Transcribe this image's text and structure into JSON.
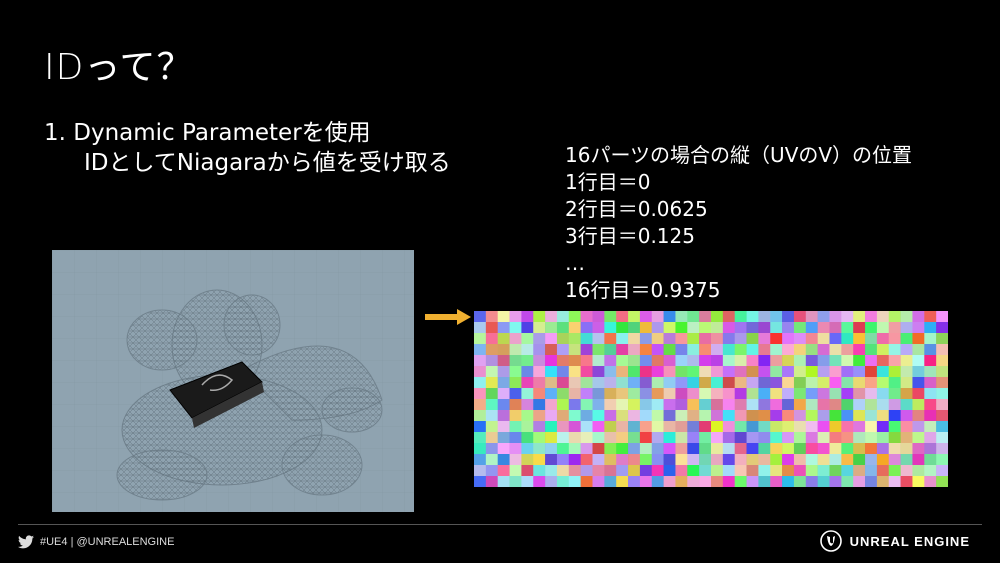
{
  "slide": {
    "title": "IDって？",
    "bullet_line1": "1. Dynamic Parameterを使用",
    "bullet_line2": "IDとしてNiagaraから値を受け取る"
  },
  "uv_info": {
    "heading": "16パーツの場合の縦（UVのV）の位置",
    "rows": [
      "1行目＝0",
      "2行目＝0.0625",
      "3行目＝0.125",
      "…",
      "16行目＝0.9375"
    ]
  },
  "footer": {
    "social": "#UE4 | @UNREALENGINE",
    "brand": "UNREAL ENGINE"
  },
  "colors": {
    "accent_arrow": "#f0b030",
    "viewport_bg": "#8fa3b0"
  },
  "icons": [
    "twitter-icon",
    "unreal-engine-logo",
    "arrow-right-icon"
  ]
}
